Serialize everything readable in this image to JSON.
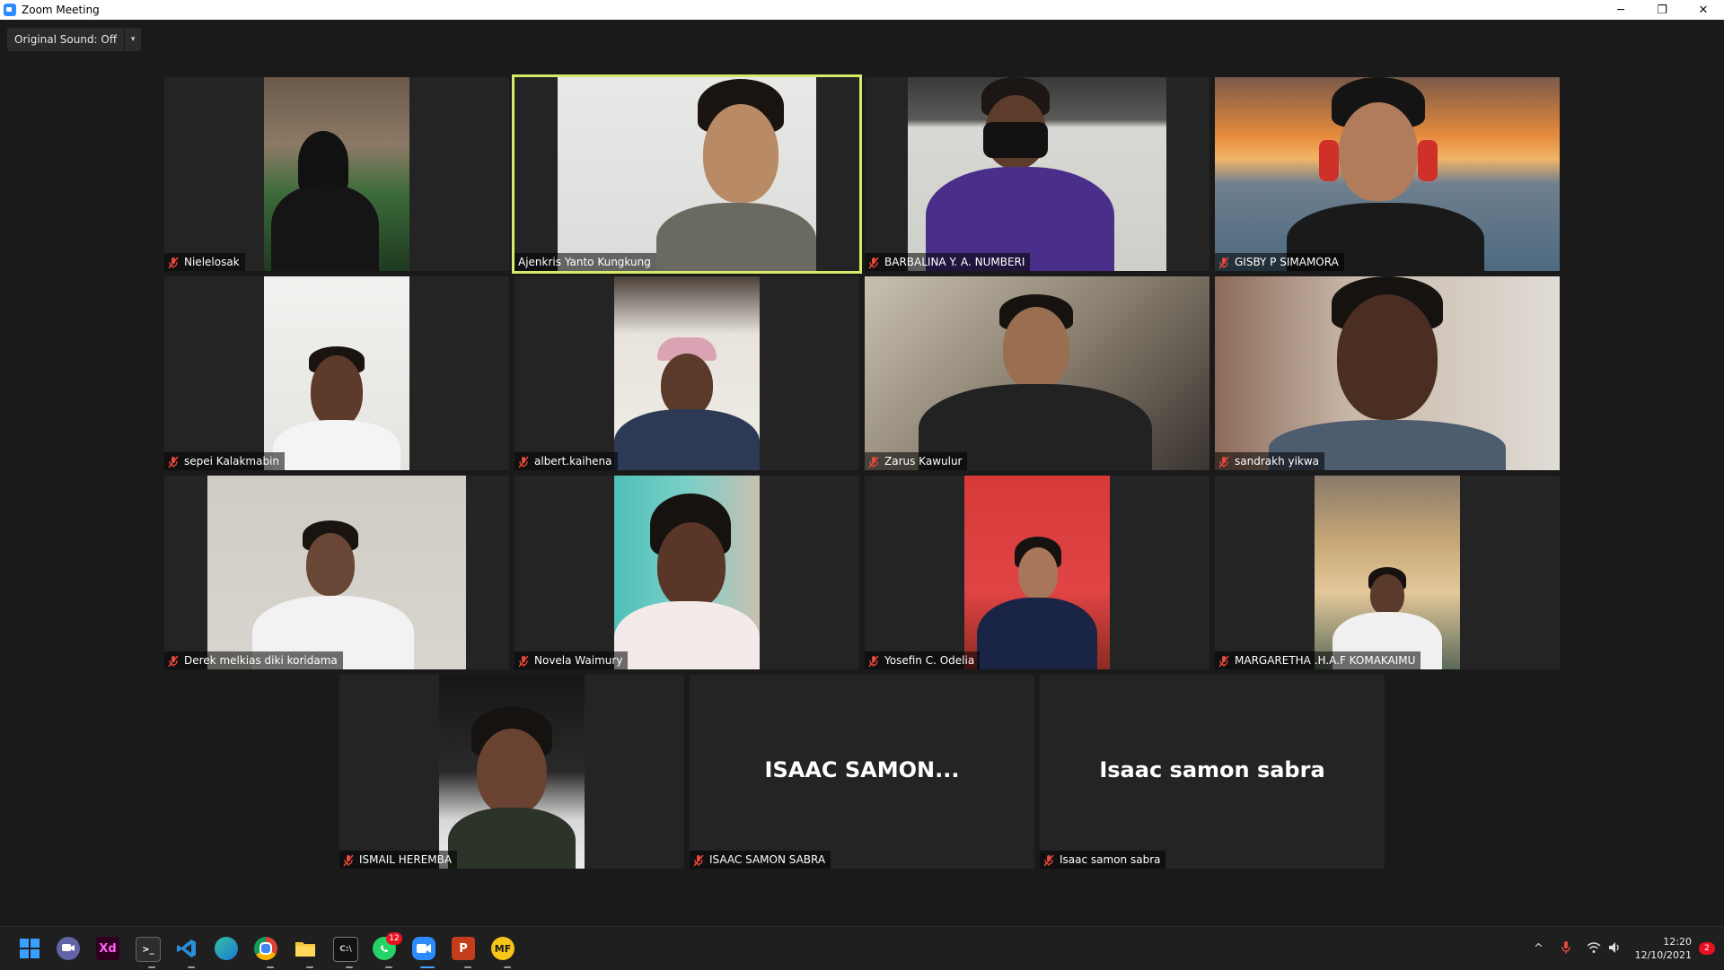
{
  "window": {
    "title": "Zoom Meeting"
  },
  "window_controls": {
    "minimize": "─",
    "restore": "❐",
    "close": "✕"
  },
  "audio": {
    "original_sound_label": "Original Sound: Off",
    "caret": "▾"
  },
  "participants": [
    {
      "name": "Nielelosak"
    },
    {
      "name": "Ajenkris Yanto Kungkung"
    },
    {
      "name": "BARBALINA Y. A. NUMBERI"
    },
    {
      "name": "GISBY P SIMAMORA"
    },
    {
      "name": "sepei Kalakmabin"
    },
    {
      "name": "albert.kaihena"
    },
    {
      "name": "Zarus Kawulur"
    },
    {
      "name": "sandrakh yikwa"
    },
    {
      "name": "Derek melkias diki koridama"
    },
    {
      "name": "Novela Waimury"
    },
    {
      "name": "Yosefin C. Odelia"
    },
    {
      "name": "MARGARETHA .H.A.F KOMAKAIMU"
    },
    {
      "name": "ISMAIL HEREMBA"
    },
    {
      "name": "ISAAC SAMON SABRA",
      "display_text": "ISAAC  SAMON..."
    },
    {
      "name": "Isaac samon sabra",
      "display_text": "Isaac samon sabra"
    }
  ],
  "taskbar": {
    "apps": [
      {
        "name": "start",
        "glyph": ""
      },
      {
        "name": "teams-chat",
        "glyph": ""
      },
      {
        "name": "adobe-xd",
        "glyph": "Xd"
      },
      {
        "name": "terminal",
        "glyph": ">_"
      },
      {
        "name": "vscode",
        "glyph": ""
      },
      {
        "name": "edge",
        "glyph": ""
      },
      {
        "name": "chrome",
        "glyph": ""
      },
      {
        "name": "file-explorer",
        "glyph": ""
      },
      {
        "name": "cmd",
        "glyph": ""
      },
      {
        "name": "whatsapp",
        "glyph": "",
        "badge": "12"
      },
      {
        "name": "zoom",
        "glyph": ""
      },
      {
        "name": "powerpoint",
        "glyph": "P"
      },
      {
        "name": "mf-app",
        "glyph": "MF"
      }
    ],
    "tray": {
      "chevron": "^",
      "time": "12:20",
      "date": "12/10/2021",
      "notifications": "2"
    }
  },
  "colors": {
    "active_speaker": "#d9ea68",
    "tile_bg": "#242424",
    "accent": "#2d8cff",
    "mute": "#e8483b"
  }
}
